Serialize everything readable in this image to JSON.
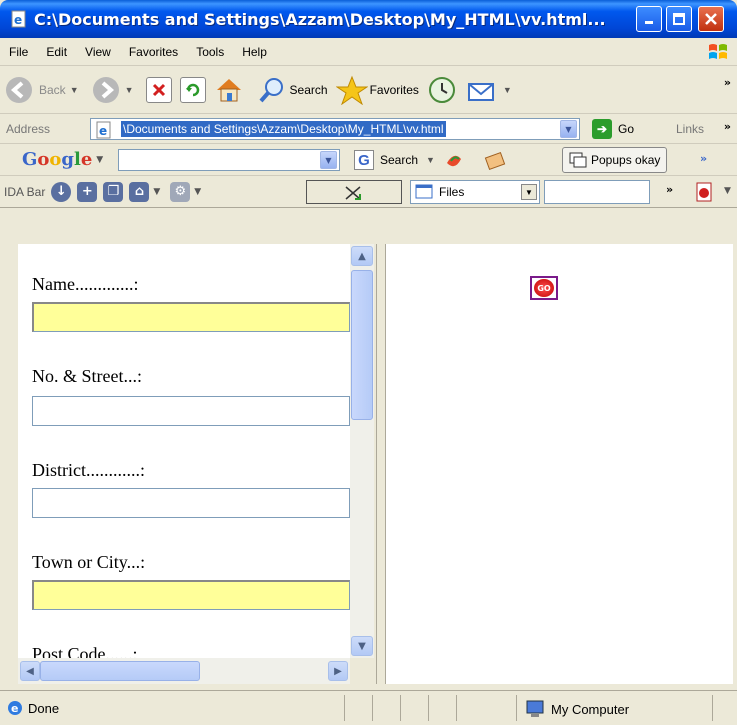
{
  "window": {
    "title": "C:\\Documents and Settings\\Azzam\\Desktop\\My_HTML\\vv.html..."
  },
  "menu": {
    "items": [
      "File",
      "Edit",
      "View",
      "Favorites",
      "Tools",
      "Help"
    ]
  },
  "toolbar": {
    "back_label": "Back",
    "search_label": "Search",
    "favorites_label": "Favorites"
  },
  "address": {
    "label": "Address",
    "value": "\\Documents and Settings\\Azzam\\Desktop\\My_HTML\\vv.html",
    "go_label": "Go",
    "links_label": "Links"
  },
  "google": {
    "logo": "Google",
    "search_label": "Search",
    "popups_label": "Popups okay"
  },
  "ida": {
    "label": "IDA Bar",
    "files_label": "Files"
  },
  "form": {
    "fields": [
      {
        "label": "Name.............:",
        "style": "yellow"
      },
      {
        "label": "No. & Street...:",
        "style": "white"
      },
      {
        "label": "District............:",
        "style": "white"
      },
      {
        "label": "Town or City...:",
        "style": "yellow"
      },
      {
        "label": "Post Code......:",
        "style": "white"
      }
    ]
  },
  "right_frame": {
    "go_image_text": "GO"
  },
  "status": {
    "text": "Done",
    "zone": "My Computer"
  }
}
